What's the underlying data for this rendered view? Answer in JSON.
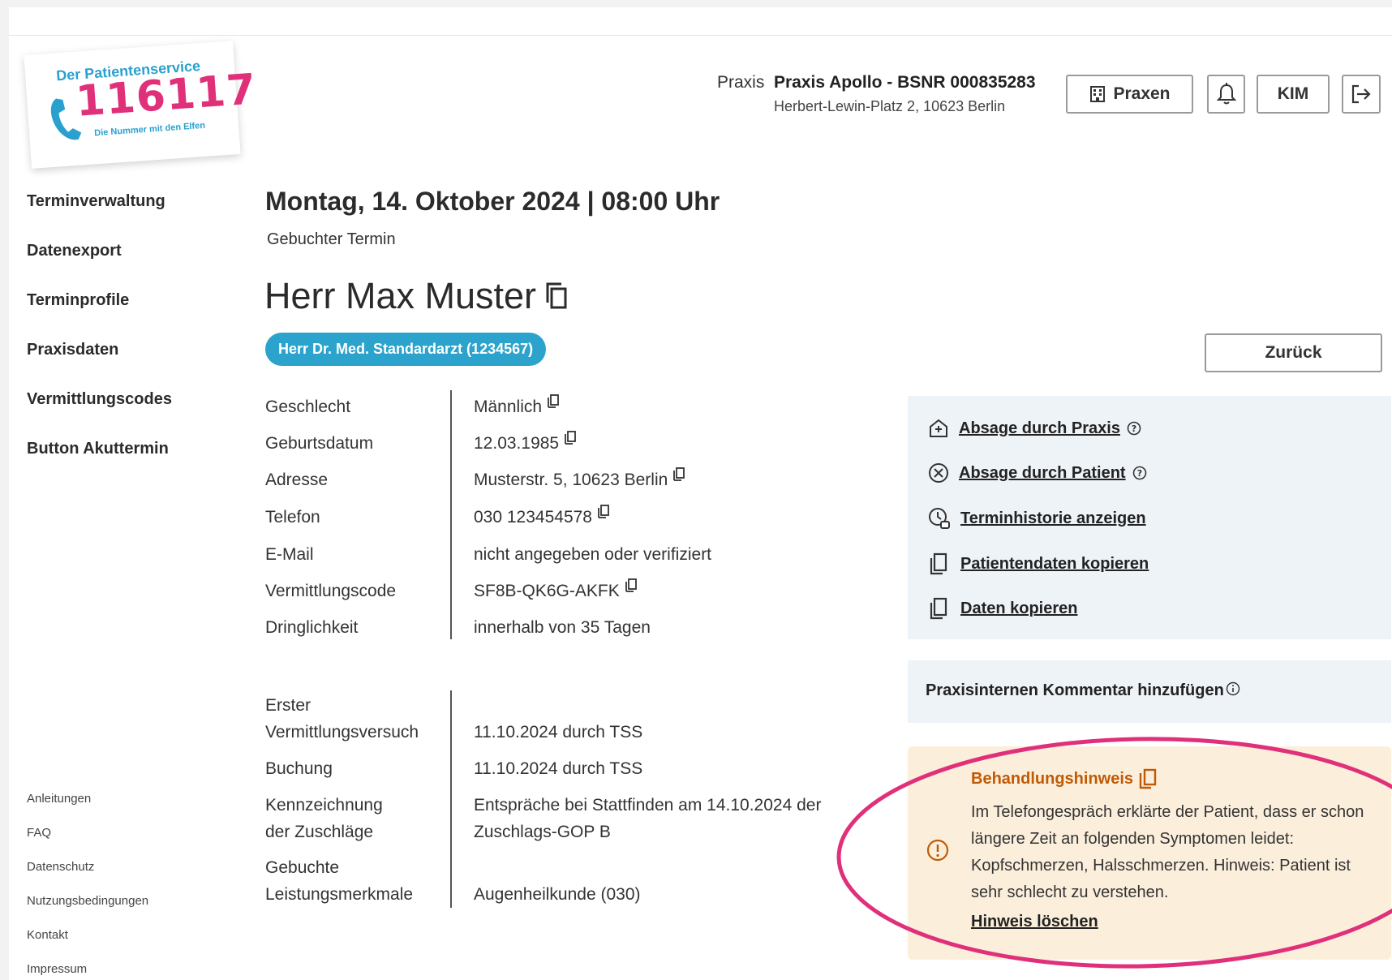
{
  "logo": {
    "title": "Der Patientenservice",
    "number": "116117",
    "subtitle": "Die Nummer mit den Elfen"
  },
  "header": {
    "praxis_label": "Praxis",
    "praxis_name": "Praxis Apollo - BSNR 000835283",
    "praxis_address": "Herbert-Lewin-Platz 2, 10623 Berlin",
    "buttons": {
      "praxen": "Praxen",
      "kim": "KIM"
    }
  },
  "sidebar": {
    "nav": [
      {
        "label": "Terminverwaltung"
      },
      {
        "label": "Datenexport"
      },
      {
        "label": "Terminprofile"
      },
      {
        "label": "Praxisdaten"
      },
      {
        "label": "Vermittlungscodes"
      },
      {
        "label": "Button Akuttermin"
      }
    ],
    "footer": [
      {
        "label": "Anleitungen"
      },
      {
        "label": "FAQ"
      },
      {
        "label": "Datenschutz"
      },
      {
        "label": "Nutzungsbedingungen"
      },
      {
        "label": "Kontakt"
      },
      {
        "label": "Impressum"
      }
    ]
  },
  "appointment": {
    "date_heading": "Montag, 14. Oktober 2024 | 08:00 Uhr",
    "status": "Gebuchter Termin",
    "patient_name": "Herr Max Muster",
    "doctor": "Herr Dr. Med. Standardarzt (1234567)",
    "back_label": "Zurück"
  },
  "details": {
    "geschlecht_label": "Geschlecht",
    "geschlecht_value": "Männlich",
    "geburtsdatum_label": "Geburtsdatum",
    "geburtsdatum_value": "12.03.1985",
    "adresse_label": "Adresse",
    "adresse_value": "Musterstr. 5, 10623 Berlin",
    "telefon_label": "Telefon",
    "telefon_value": "030 123454578",
    "email_label": "E-Mail",
    "email_value": "nicht angegeben oder verifiziert",
    "vermittlungscode_label": "Vermittlungscode",
    "vermittlungscode_value": "SF8B-QK6G-AKFK",
    "dringlichkeit_label": "Dringlichkeit",
    "dringlichkeit_value": "innerhalb von 35 Tagen"
  },
  "details2": {
    "erster_label_1": "Erster",
    "erster_label_2": "Vermittlungsversuch",
    "erster_value": "11.10.2024 durch TSS",
    "buchung_label": "Buchung",
    "buchung_value": "11.10.2024 durch TSS",
    "kennz_label_1": "Kennzeichnung",
    "kennz_label_2": "der Zuschläge",
    "kennz_value_1": "Entspräche bei Stattfinden am 14.10.2024 der",
    "kennz_value_2": "Zuschlags-GOP B",
    "leist_label_1": "Gebuchte",
    "leist_label_2": "Leistungsmerkmale",
    "leist_value": "Augenheilkunde (030)"
  },
  "actions": {
    "absage_praxis": "Absage durch Praxis",
    "absage_patient": "Absage durch Patient",
    "historie": "Terminhistorie anzeigen",
    "patientendaten": "Patientendaten kopieren",
    "daten": "Daten kopieren"
  },
  "comment": {
    "label": "Praxisinternen Kommentar hinzufügen"
  },
  "hint": {
    "title": "Behandlungshinweis",
    "body": "Im Telefongespräch erklärte der Patient, dass er schon längere Zeit an folgenden Symptomen leidet: Kopfschmerzen, Halsschmerzen. Hinweis: Patient ist sehr schlecht zu verstehen.",
    "delete_label": "Hinweis löschen"
  },
  "colors": {
    "accent_blue": "#2ba3cc",
    "hint_orange": "#c05a05",
    "hint_background": "#fbefdc",
    "highlight_pink": "#e0307a",
    "panel_background": "#eef3f7"
  }
}
